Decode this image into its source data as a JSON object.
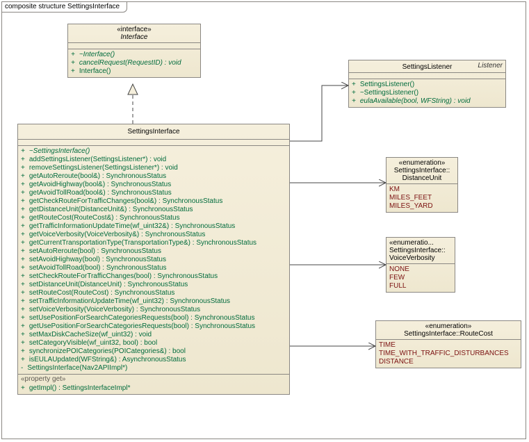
{
  "frame": {
    "title": "composite structure SettingsInterface"
  },
  "interface_box": {
    "stereo": "«interface»",
    "name": "Interface",
    "ops": [
      {
        "text": "~Interface()",
        "italic": true
      },
      {
        "text": "cancelRequest(RequestID) : void",
        "italic": true
      },
      {
        "text": "Interface()",
        "italic": false
      }
    ]
  },
  "listener_box": {
    "corner": "Listener",
    "name": "SettingsListener",
    "ops": [
      {
        "text": "SettingsListener()"
      },
      {
        "text": "~SettingsListener()"
      },
      {
        "text": "eulaAvailable(bool, WFString) : void",
        "italic": true
      }
    ]
  },
  "settings_box": {
    "name": "SettingsInterface",
    "ops": [
      {
        "text": "~SettingsInterface()",
        "italic": true
      },
      {
        "text": "addSettingsListener(SettingsListener*) : void"
      },
      {
        "text": "removeSettingsListener(SettingsListener*) : void"
      },
      {
        "text": "getAutoReroute(bool&) : SynchronousStatus"
      },
      {
        "text": "getAvoidHighway(bool&) : SynchronousStatus"
      },
      {
        "text": "getAvoidTollRoad(bool&) : SynchronousStatus"
      },
      {
        "text": "getCheckRouteForTrafficChanges(bool&) : SynchronousStatus"
      },
      {
        "text": "getDistanceUnit(DistanceUnit&) : SynchronousStatus"
      },
      {
        "text": "getRouteCost(RouteCost&) : SynchronousStatus"
      },
      {
        "text": "getTrafficInformationUpdateTime(wf_uint32&) : SynchronousStatus"
      },
      {
        "text": "getVoiceVerbosity(VoiceVerbosity&) : SynchronousStatus"
      },
      {
        "text": "getCurrentTransportationType(TransportationType&) : SynchronousStatus"
      },
      {
        "text": "setAutoReroute(bool) : SynchronousStatus"
      },
      {
        "text": "setAvoidHighway(bool) : SynchronousStatus"
      },
      {
        "text": "setAvoidTollRoad(bool) : SynchronousStatus"
      },
      {
        "text": "setCheckRouteForTrafficChanges(bool) : SynchronousStatus"
      },
      {
        "text": "setDistanceUnit(DistanceUnit) : SynchronousStatus"
      },
      {
        "text": "setRouteCost(RouteCost) : SynchronousStatus"
      },
      {
        "text": "setTrafficInformationUpdateTime(wf_uint32) : SynchronousStatus"
      },
      {
        "text": "setVoiceVerbosity(VoiceVerbosity) : SynchronousStatus"
      },
      {
        "text": "setUsePositionForSearchCategoriesRequests(bool) : SynchronousStatus"
      },
      {
        "text": "getUsePositionForSearchCategoriesRequests(bool) : SynchronousStatus"
      },
      {
        "text": "setMaxDiskCacheSize(wf_uint32) : void"
      },
      {
        "text": "setCategoryVisible(wf_uint32, bool) : bool"
      },
      {
        "text": "synchronizePOICategories(POICategories&) : bool"
      },
      {
        "text": "isEULAUpdated(WFString&) : AsynchronousStatus"
      },
      {
        "text": "SettingsInterface(Nav2APIImpl*)",
        "vis": "-"
      }
    ],
    "prop_label": "«property get»",
    "props": [
      {
        "text": "getImpl() : SettingsInterfaceImpl*"
      }
    ]
  },
  "enum_distance": {
    "stereo": "«enumeration»",
    "name": "SettingsInterface::",
    "name2": "DistanceUnit",
    "values": [
      "KM",
      "MILES_FEET",
      "MILES_YARD"
    ]
  },
  "enum_voice": {
    "stereo": "«enumeratio...",
    "name": "SettingsInterface::",
    "name2": "VoiceVerbosity",
    "values": [
      "NONE",
      "FEW",
      "FULL"
    ]
  },
  "enum_route": {
    "stereo": "«enumeration»",
    "name": "SettingsInterface::RouteCost",
    "values": [
      "TIME",
      "TIME_WITH_TRAFFIC_DISTURBANCES",
      "DISTANCE"
    ]
  }
}
